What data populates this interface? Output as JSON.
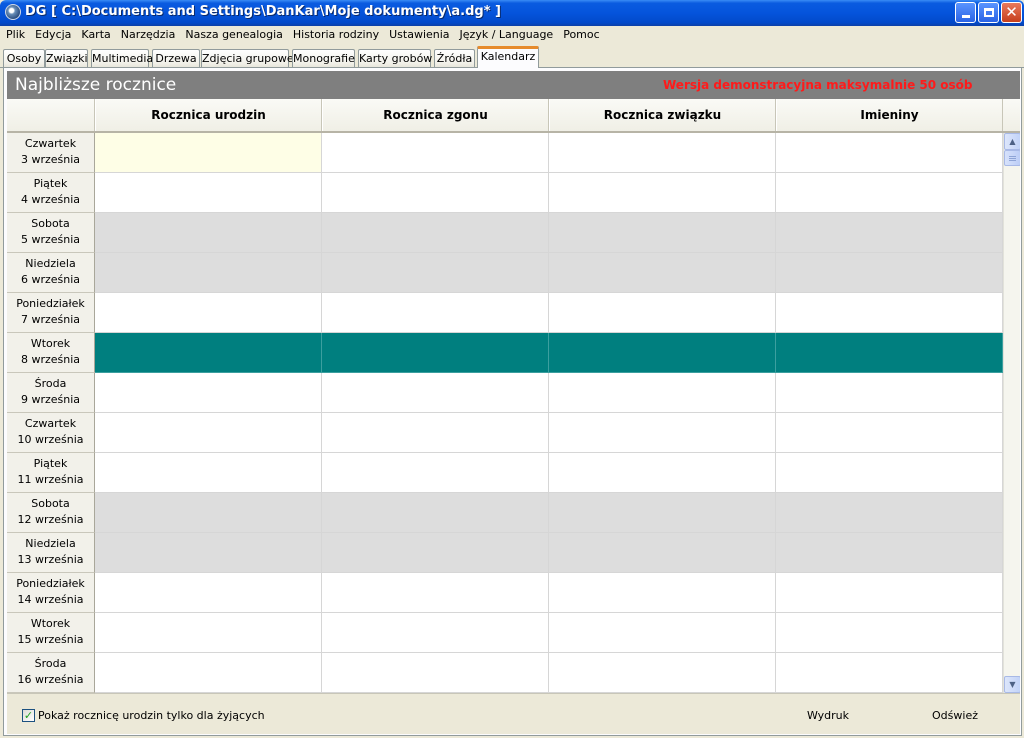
{
  "window": {
    "title": "DG [ C:\\Documents and Settings\\DanKar\\Moje dokumenty\\a.dg* ]",
    "app_icon": "genealogy-app-icon",
    "buttons": {
      "minimize": "minimize-icon",
      "maximize": "restore-icon",
      "close": "close-icon"
    }
  },
  "menu": [
    "Plik",
    "Edycja",
    "Karta",
    "Narzędzia",
    "Nasza genealogia",
    "Historia rodziny",
    "Ustawienia",
    "Język / Language",
    "Pomoc"
  ],
  "tabs": [
    {
      "label": "Osoby"
    },
    {
      "label": "Związki"
    },
    {
      "label": "Multimedia"
    },
    {
      "label": "Drzewa"
    },
    {
      "label": "Zdjęcia grupowe"
    },
    {
      "label": "Monografie"
    },
    {
      "label": "Karty grobów"
    },
    {
      "label": "Źródła"
    },
    {
      "label": "Kalendarz",
      "active": true
    }
  ],
  "panel": {
    "title": "Najbliższe rocznice",
    "demo_notice": "Wersja demonstracyjna maksymalnie 50 osób"
  },
  "columns": [
    "Rocznica urodzin",
    "Rocznica zgonu",
    "Rocznica związku",
    "Imieniny"
  ],
  "rows": [
    {
      "day": "Czwartek",
      "date": "3 września",
      "type": "normal",
      "selected": true
    },
    {
      "day": "Piątek",
      "date": "4 września",
      "type": "normal"
    },
    {
      "day": "Sobota",
      "date": "5 września",
      "type": "weekend"
    },
    {
      "day": "Niedziela",
      "date": "6 września",
      "type": "weekend"
    },
    {
      "day": "Poniedziałek",
      "date": "7 września",
      "type": "normal"
    },
    {
      "day": "Wtorek",
      "date": "8 września",
      "type": "today"
    },
    {
      "day": "Środa",
      "date": "9 września",
      "type": "normal"
    },
    {
      "day": "Czwartek",
      "date": "10 września",
      "type": "normal"
    },
    {
      "day": "Piątek",
      "date": "11 września",
      "type": "normal"
    },
    {
      "day": "Sobota",
      "date": "12 września",
      "type": "weekend"
    },
    {
      "day": "Niedziela",
      "date": "13 września",
      "type": "weekend"
    },
    {
      "day": "Poniedziałek",
      "date": "14 września",
      "type": "normal"
    },
    {
      "day": "Wtorek",
      "date": "15 września",
      "type": "normal"
    },
    {
      "day": "Środa",
      "date": "16 września",
      "type": "normal"
    }
  ],
  "footer": {
    "checkbox_label": "Pokaż rocznicę urodzin tylko dla żyjących",
    "checkbox_checked": true,
    "print_label": "Wydruk",
    "refresh_label": "Odśwież"
  },
  "colors": {
    "today_row": "#007f7f",
    "weekend_row": "#dddddd",
    "demo_notice": "#ff1a1a",
    "header_bar": "#7f7f7f"
  }
}
